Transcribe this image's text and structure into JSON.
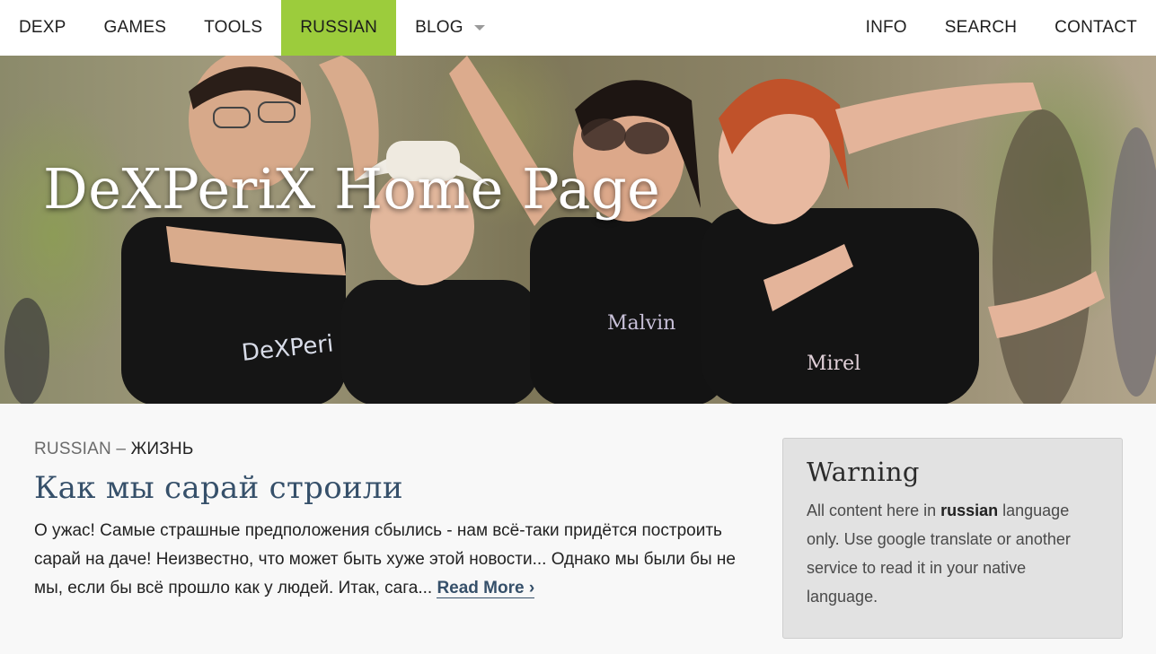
{
  "nav": {
    "left": [
      "DEXP",
      "GAMES",
      "TOOLS",
      "RUSSIAN",
      "BLOG"
    ],
    "active": "RUSSIAN",
    "right": [
      "INFO",
      "SEARCH",
      "CONTACT"
    ]
  },
  "hero": {
    "title": "DeXPeriX Home Page",
    "shirt_texts": [
      "DeXPeri",
      "Malvin",
      "Mirel"
    ]
  },
  "article": {
    "category": "RUSSIAN",
    "separator": "–",
    "tag": "ЖИЗНЬ",
    "title": "Как мы сарай строили",
    "excerpt": "О ужас! Самые страшные предположения сбылись - нам всё-таки придётся построить сарай на даче! Неизвестно, что может быть хуже этой новости... Однако мы были бы не мы, если бы всё прошло как у людей. Итак, сага...",
    "read_more": "Read More ›"
  },
  "widget": {
    "title": "Warning",
    "text_before": "All content here in ",
    "text_bold": "russian",
    "text_after": " language only. Use google translate or another service to read it in your native language."
  },
  "colors": {
    "nav_active_bg": "#9ccc3c",
    "title_link": "#36506a",
    "widget_bg": "#e2e2e2"
  }
}
